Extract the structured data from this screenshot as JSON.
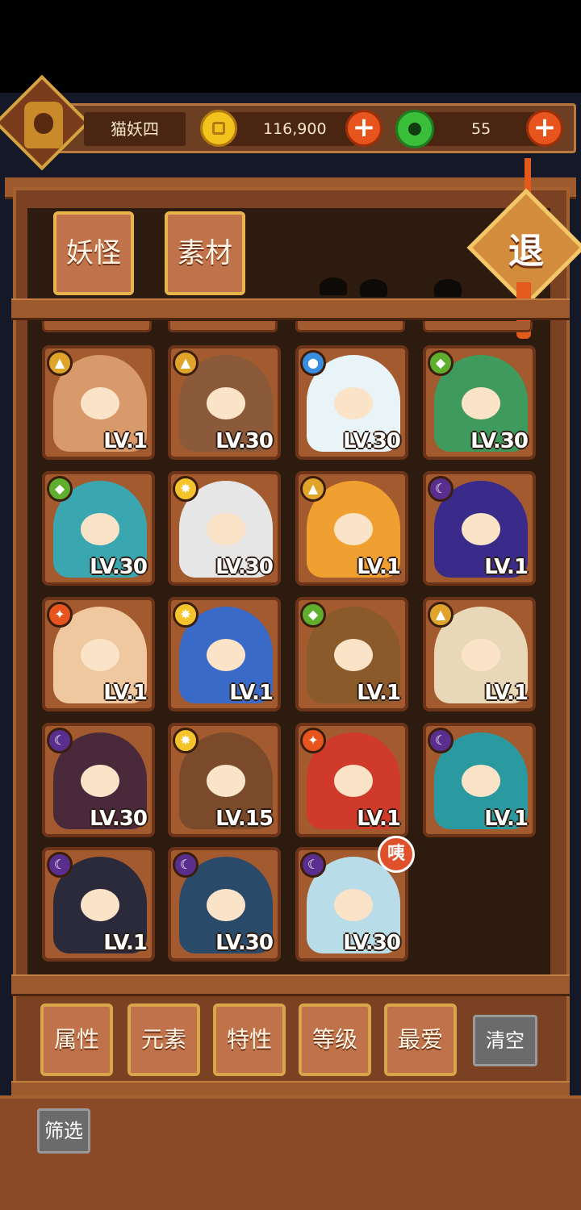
{
  "player": {
    "name": "猫妖四",
    "avatar_icon": "temple-lantern-icon"
  },
  "currency": {
    "coins": "116,900",
    "coin_icon": "gold-coin-icon",
    "gems": "55",
    "gem_icon": "green-jade-icon",
    "add_label": "+"
  },
  "tabs": [
    {
      "label": "妖怪"
    },
    {
      "label": "素材"
    }
  ],
  "exit_label": "退",
  "monsters": [
    {
      "level": "LV.1",
      "element": "earth",
      "element_color": "#e0a42a",
      "color": "#d89a6a"
    },
    {
      "level": "LV.30",
      "element": "earth",
      "element_color": "#e0a42a",
      "color": "#8a5a3a"
    },
    {
      "level": "LV.30",
      "element": "water",
      "element_color": "#3a8ee0",
      "color": "#e8f4f8"
    },
    {
      "level": "LV.30",
      "element": "wood",
      "element_color": "#5fae2e",
      "color": "#3f9a5e"
    },
    {
      "level": "LV.30",
      "element": "wood",
      "element_color": "#5fae2e",
      "color": "#3aa6b0"
    },
    {
      "level": "LV.30",
      "element": "light",
      "element_color": "#f4c42c",
      "color": "#e6e6e6"
    },
    {
      "level": "LV.1",
      "element": "earth",
      "element_color": "#e0a42a",
      "color": "#f0a030"
    },
    {
      "level": "LV.1",
      "element": "dark",
      "element_color": "#5a2e8e",
      "color": "#3a2a8a"
    },
    {
      "level": "LV.1",
      "element": "fire",
      "element_color": "#e8541d",
      "color": "#f0c8a0"
    },
    {
      "level": "LV.1",
      "element": "light",
      "element_color": "#f4c42c",
      "color": "#3a6ac8"
    },
    {
      "level": "LV.1",
      "element": "wood",
      "element_color": "#5fae2e",
      "color": "#8a5a2a"
    },
    {
      "level": "LV.1",
      "element": "earth",
      "element_color": "#e0a42a",
      "color": "#e8d8b8"
    },
    {
      "level": "LV.30",
      "element": "dark",
      "element_color": "#5a2e8e",
      "color": "#4a2a3a"
    },
    {
      "level": "LV.15",
      "element": "light",
      "element_color": "#f4c42c",
      "color": "#7a4a2a"
    },
    {
      "level": "LV.1",
      "element": "fire",
      "element_color": "#e8541d",
      "color": "#d03a2a"
    },
    {
      "level": "LV.1",
      "element": "dark",
      "element_color": "#5a2e8e",
      "color": "#2a9aa0"
    },
    {
      "level": "LV.1",
      "element": "dark",
      "element_color": "#5a2e8e",
      "color": "#2a2a3a"
    },
    {
      "level": "LV.30",
      "element": "dark",
      "element_color": "#5a2e8e",
      "color": "#2a4a6a"
    },
    {
      "level": "LV.30",
      "element": "dark",
      "element_color": "#5a2e8e",
      "color": "#b8dde8"
    }
  ],
  "new_badge": "咦",
  "filters": [
    {
      "label": "属性"
    },
    {
      "label": "元素"
    },
    {
      "label": "特性"
    },
    {
      "label": "等级"
    },
    {
      "label": "最爱"
    }
  ],
  "clear_label": "清空",
  "screen_label": "筛选"
}
